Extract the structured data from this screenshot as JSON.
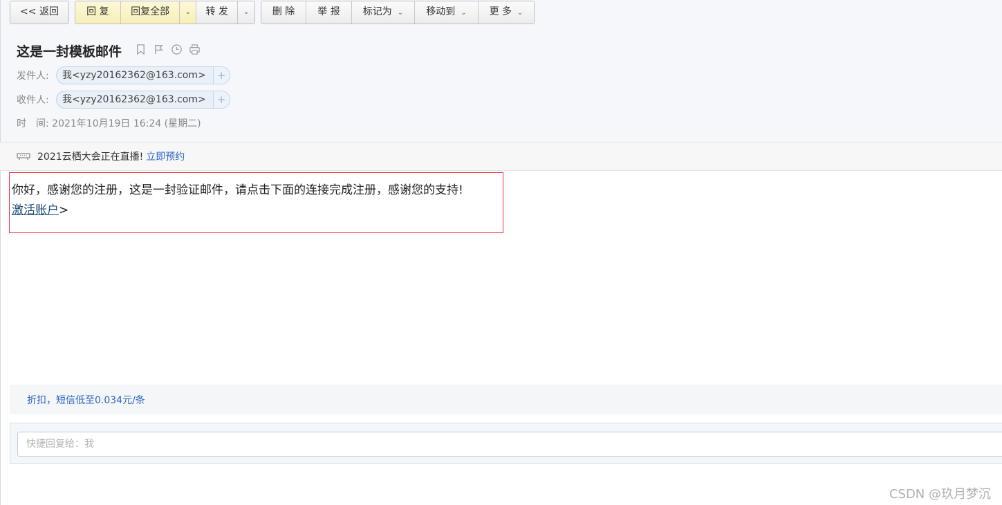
{
  "toolbar": {
    "back": "<< 返回",
    "reply": "回 复",
    "reply_all": "回复全部",
    "forward": "转 发",
    "delete": "删 除",
    "report": "举 报",
    "mark_as": "标记为",
    "move_to": "移动到",
    "more": "更 多",
    "caret": "⌄"
  },
  "mail": {
    "subject": "这是一封模板邮件",
    "from_label": "发件人:",
    "from_value": "我<yzy20162362@163.com>",
    "to_label": "收件人:",
    "to_value": "我<yzy20162362@163.com>",
    "add_contact": "+",
    "time_label": "时　间:",
    "time_value": "2021年10月19日 16:24 (星期二)"
  },
  "banner": {
    "text": "2021云栖大会正在直播!",
    "link": "立即预约"
  },
  "body": {
    "line1": "你好，感谢您的注册，这是一封验证邮件，请点击下面的连接完成注册，感谢您的支持!",
    "link": "激活账户",
    "after_link": ">"
  },
  "ad": {
    "text": "折扣，短信低至0.034元/条"
  },
  "quick_reply": {
    "placeholder": "快捷回复给：我"
  },
  "watermark": "CSDN @玖月梦沉",
  "colors": {
    "accent_link": "#2b65c4",
    "reply_yellow": "#f7efb8",
    "body_border": "#e0373b"
  }
}
